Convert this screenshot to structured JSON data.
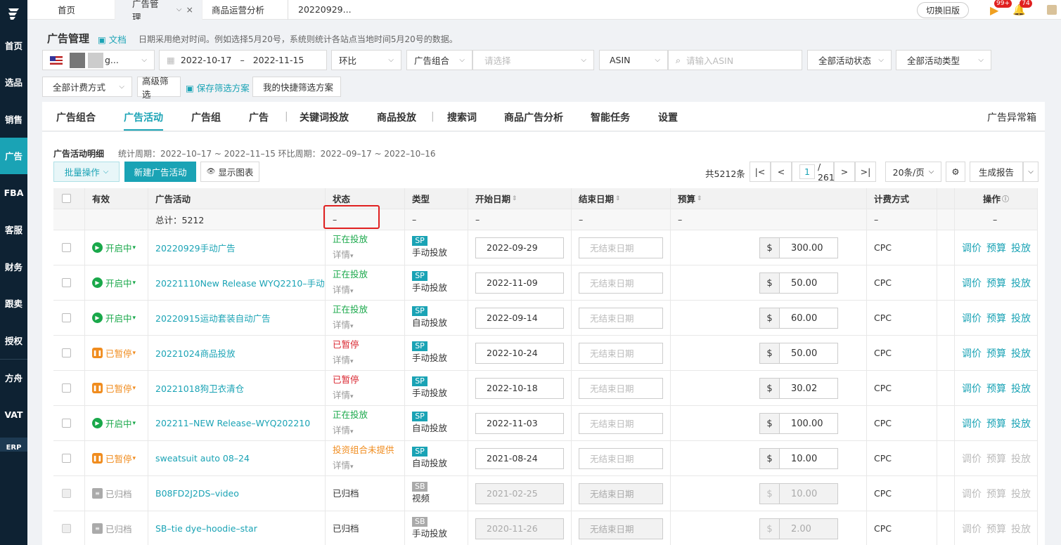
{
  "sidebar": {
    "items": [
      "首页",
      "选品",
      "销售",
      "广告",
      "FBA",
      "客服",
      "财务",
      "跟卖",
      "授权",
      "方舟",
      "VAT",
      "ERP"
    ],
    "active": "广告"
  },
  "tabs": [
    {
      "label": "首页"
    },
    {
      "label": "广告管理"
    },
    {
      "label": "商品运营分析"
    },
    {
      "label": "20220929..."
    }
  ],
  "topbar": {
    "switch_old": "切换旧版",
    "badge1": "99+",
    "badge2": "74"
  },
  "page": {
    "title": "广告管理",
    "doc": "文档",
    "hint": "日期采用绝对时间。例如选择5月20号，系统则统计各站点当地时间5月20号的数据。"
  },
  "filters": {
    "store": "g...",
    "date_start": "2022-10-17",
    "date_sep": "–",
    "date_end": "2022-11-15",
    "compare": "环比",
    "portfolio": "广告组合",
    "portfolio_placeholder": "请选择",
    "asin_type": "ASIN",
    "asin_placeholder": "请输入ASIN",
    "status_all": "全部活动状态",
    "type_all": "全部活动类型",
    "billing_all": "全部计费方式",
    "advanced": "高级筛选",
    "save_scheme": "保存筛选方案",
    "my_schemes": "我的快捷筛选方案"
  },
  "nav": {
    "items": [
      "广告组合",
      "广告活动",
      "广告组",
      "广告",
      "关键词投放",
      "商品投放",
      "搜索词",
      "商品广告分析",
      "智能任务",
      "设置"
    ],
    "active": "广告活动",
    "right": "广告异常箱"
  },
  "panel": {
    "title": "广告活动明细",
    "period": "统计周期：2022–10–17 ~ 2022–11–15 环比周期：2022–09–17 ~ 2022–10–16",
    "batch": "批量操作",
    "new_campaign": "新建广告活动",
    "show_chart": "显示图表",
    "total": "共5212条",
    "page_current": "1",
    "page_total": "/ 261",
    "page_size": "20条/页",
    "report": "生成报告"
  },
  "table": {
    "headers": {
      "valid": "有效",
      "campaign": "广告活动",
      "status": "状态",
      "type": "类型",
      "start": "开始日期",
      "end": "结束日期",
      "budget": "预算",
      "billing": "计费方式",
      "ops": "操作"
    },
    "total_label": "总计：5212",
    "dash": "–",
    "detail": "详情",
    "currency": "$",
    "op_labels": [
      "调价",
      "预算",
      "投放"
    ],
    "rows": [
      {
        "valid": "开启中",
        "state": "on",
        "name": "20220929手动广告",
        "status": "正在投放",
        "status_color": "green",
        "badge": "SP",
        "target": "手动投放",
        "start": "2022-09-29",
        "end": "无结束日期",
        "budget": "300.00",
        "billing": "CPC"
      },
      {
        "valid": "开启中",
        "state": "on",
        "name": "20221110New Release WYQ2210–手动",
        "status": "正在投放",
        "status_color": "green",
        "badge": "SP",
        "target": "手动投放",
        "start": "2022-11-09",
        "end": "无结束日期",
        "budget": "50.00",
        "billing": "CPC"
      },
      {
        "valid": "开启中",
        "state": "on",
        "name": "20220915运动套装自动广告",
        "status": "正在投放",
        "status_color": "green",
        "badge": "SP",
        "target": "自动投放",
        "start": "2022-09-14",
        "end": "无结束日期",
        "budget": "60.00",
        "billing": "CPC"
      },
      {
        "valid": "已暂停",
        "state": "paused",
        "name": "20221024商品投放",
        "status": "已暂停",
        "status_color": "red",
        "badge": "SP",
        "target": "手动投放",
        "start": "2022-10-24",
        "end": "无结束日期",
        "budget": "50.00",
        "billing": "CPC"
      },
      {
        "valid": "已暂停",
        "state": "paused",
        "name": "20221018狗卫衣清仓",
        "status": "已暂停",
        "status_color": "red",
        "badge": "SP",
        "target": "手动投放",
        "start": "2022-10-18",
        "end": "无结束日期",
        "budget": "30.02",
        "billing": "CPC"
      },
      {
        "valid": "开启中",
        "state": "on",
        "name": "202211–NEW Release–WYQ202210",
        "status": "正在投放",
        "status_color": "green",
        "badge": "SP",
        "target": "自动投放",
        "start": "2022-11-03",
        "end": "无结束日期",
        "budget": "100.00",
        "billing": "CPC"
      },
      {
        "valid": "已暂停",
        "state": "paused",
        "name": "sweatsuit auto 08–24",
        "status": "投资组合未提供",
        "status_color": "orange",
        "badge": "SP",
        "target": "自动投放",
        "start": "2021-08-24",
        "end": "无结束日期",
        "budget": "10.00",
        "billing": "CPC"
      },
      {
        "valid": "已归档",
        "state": "archived",
        "name": "B08FD2J2DS–video",
        "status": "已归档",
        "status_color": "gray",
        "badge": "SB",
        "target": "视频",
        "start": "2021-02-25",
        "end": "无结束日期",
        "budget": "10.00",
        "billing": "CPC"
      },
      {
        "valid": "已归档",
        "state": "archived",
        "name": "SB–tie dye–hoodie–star",
        "status": "已归档",
        "status_color": "gray",
        "badge": "SB",
        "target": "手动投放",
        "start": "2020-11-26",
        "end": "无结束日期",
        "budget": "2.00",
        "billing": "CPC"
      }
    ]
  },
  "colors": {
    "accent": "#1aa3b5",
    "sidebar": "#0e2233",
    "on": "#19a84a",
    "paused": "#f08c1e",
    "stopped": "#d9232d",
    "highlight": "#e02020"
  }
}
